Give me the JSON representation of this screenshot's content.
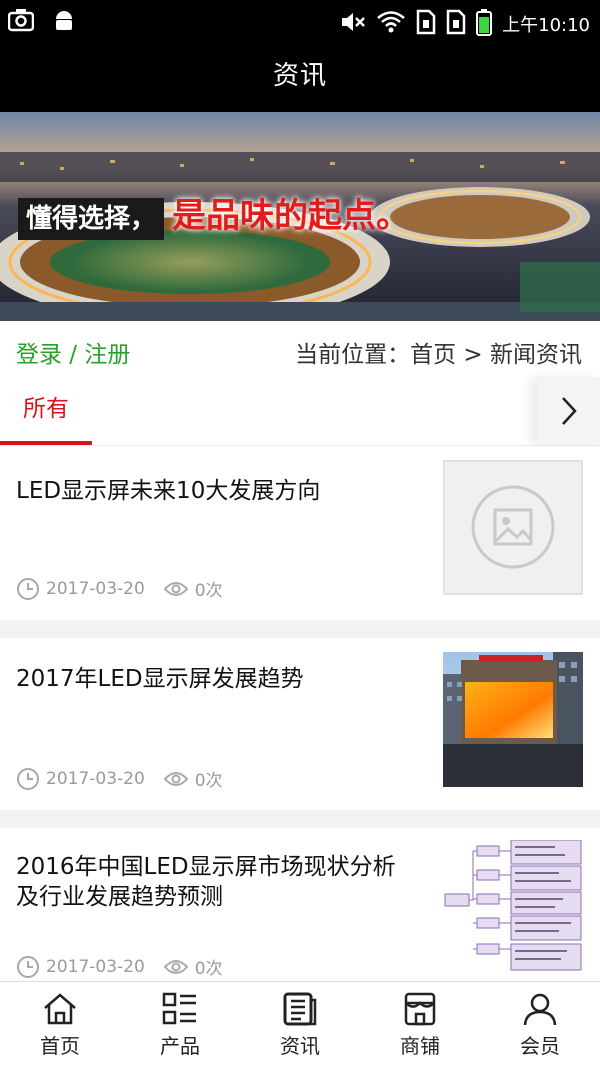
{
  "status_bar": {
    "icons": [
      "camera-icon",
      "android-icon",
      "mute-icon",
      "wifi-icon",
      "sim1-icon",
      "sim2-icon",
      "battery-icon"
    ],
    "time": "上午10:10"
  },
  "header": {
    "title": "资讯"
  },
  "banner": {
    "slogan_a": "懂得选择，",
    "slogan_b": "是品味的起点。"
  },
  "login_bar": {
    "login_link": "登录 / 注册",
    "breadcrumb": "当前位置：首页 > 新闻资讯"
  },
  "tabs": {
    "active": "所有",
    "more_icon": "chevron-right-icon"
  },
  "news": [
    {
      "title": "LED显示屏未来10大发展方向",
      "date": "2017-03-20",
      "views": "0次",
      "thumb": "placeholder-image-icon"
    },
    {
      "title": "2017年LED显示屏发展趋势",
      "date": "2017-03-20",
      "views": "0次",
      "thumb": "led-billboard-photo"
    },
    {
      "title": "2016年中国LED显示屏市场现状分析及行业发展趋势预测",
      "date": "2017-03-20",
      "views": "0次",
      "thumb": "mindmap-diagram-image"
    }
  ],
  "bottom_nav": [
    {
      "label": "首页",
      "icon": "home-icon"
    },
    {
      "label": "产品",
      "icon": "product-list-icon"
    },
    {
      "label": "资讯",
      "icon": "news-icon"
    },
    {
      "label": "商铺",
      "icon": "shop-icon"
    },
    {
      "label": "会员",
      "icon": "member-icon"
    }
  ],
  "colors": {
    "accent_red": "#d9141b",
    "login_green": "#2aa02a",
    "header_bg": "#000000"
  }
}
